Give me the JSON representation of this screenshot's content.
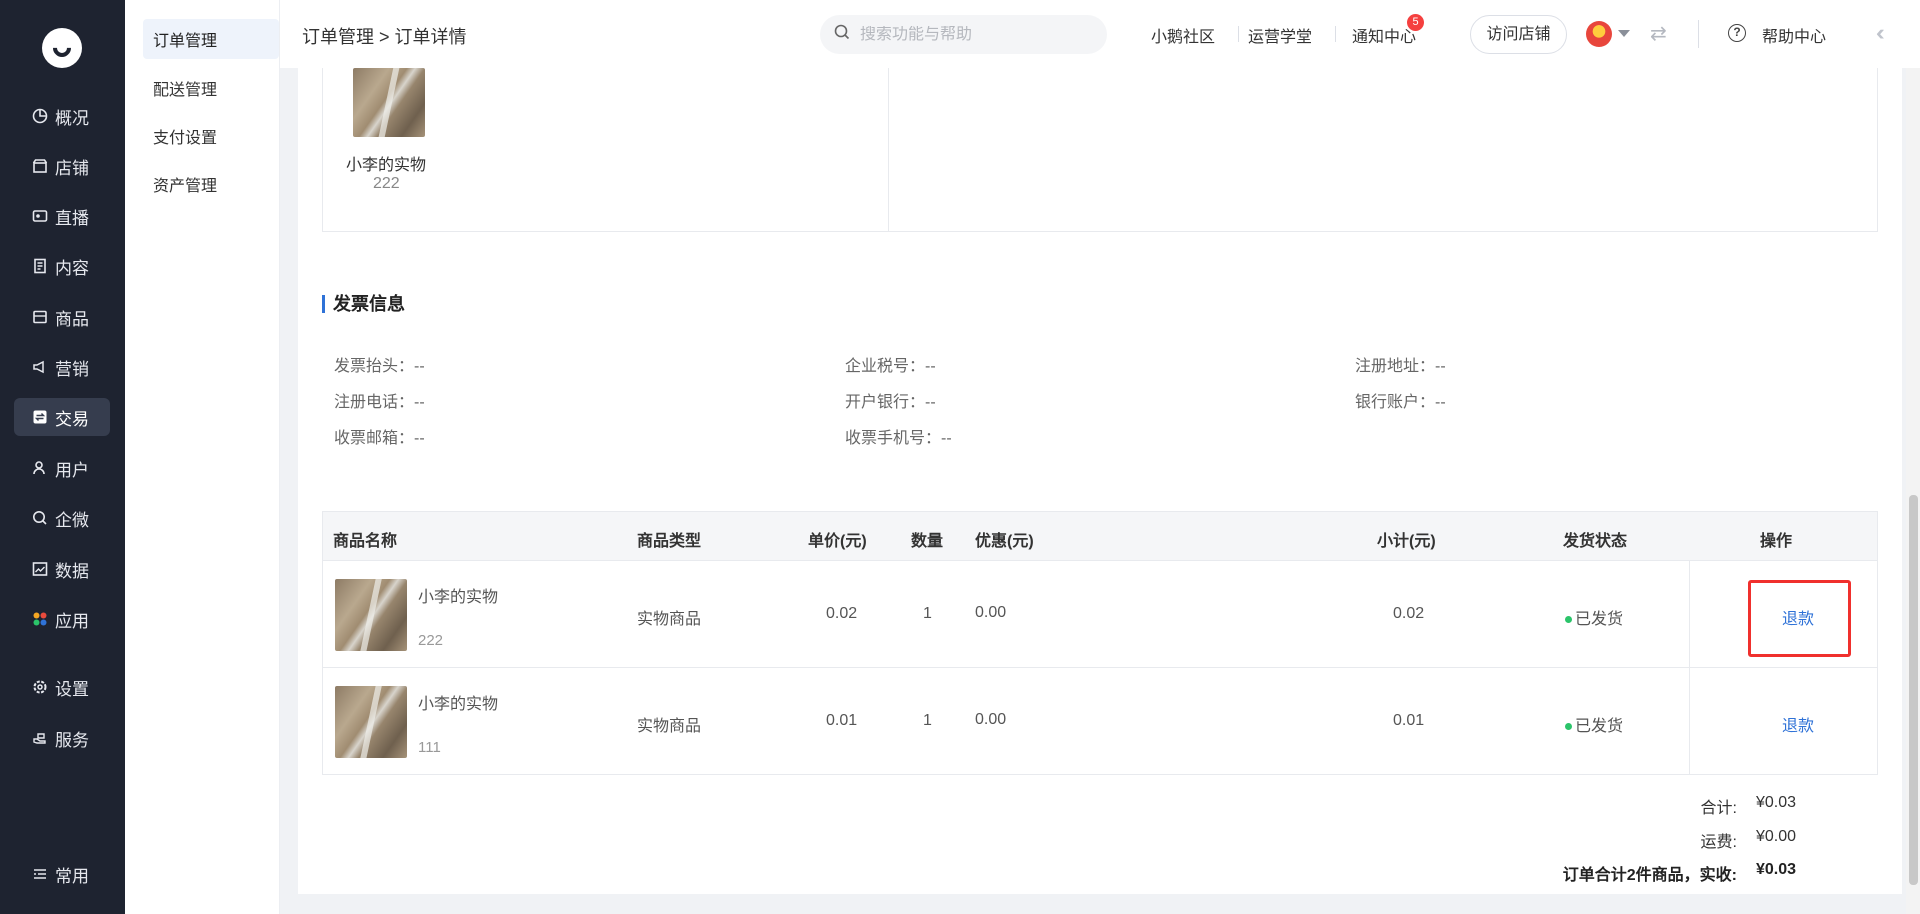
{
  "nav": {
    "items": [
      {
        "label": "概况",
        "icon": "pie-chart-icon"
      },
      {
        "label": "店铺",
        "icon": "store-icon"
      },
      {
        "label": "直播",
        "icon": "live-icon"
      },
      {
        "label": "内容",
        "icon": "document-icon"
      },
      {
        "label": "商品",
        "icon": "box-icon"
      },
      {
        "label": "营销",
        "icon": "megaphone-icon"
      },
      {
        "label": "交易",
        "icon": "exchange-icon"
      },
      {
        "label": "用户",
        "icon": "user-icon"
      },
      {
        "label": "企微",
        "icon": "wecom-icon"
      },
      {
        "label": "数据",
        "icon": "image-chart-icon"
      },
      {
        "label": "应用",
        "icon": "apps-icon"
      },
      {
        "label": "设置",
        "icon": "gear-icon"
      },
      {
        "label": "服务",
        "icon": "service-icon"
      },
      {
        "label": "常用",
        "icon": "list-icon"
      }
    ],
    "active": "交易"
  },
  "submenu": {
    "items": [
      "订单管理",
      "配送管理",
      "支付设置",
      "资产管理"
    ]
  },
  "header": {
    "breadcrumb": "订单管理 > 订单详情",
    "search_placeholder": "搜索功能与帮助",
    "community": "小鹅社区",
    "academy": "运营学堂",
    "notice": "通知中心",
    "notice_count": "5",
    "visit_store": "访问店铺",
    "help": "帮助中心"
  },
  "product_top": {
    "name": "小李的实物",
    "code": "222"
  },
  "invoice": {
    "title": "发票信息",
    "fields": [
      {
        "label": "发票抬头：",
        "value": "--"
      },
      {
        "label": "企业税号：",
        "value": "--"
      },
      {
        "label": "注册地址：",
        "value": "--"
      },
      {
        "label": "注册电话：",
        "value": "--"
      },
      {
        "label": "开户银行：",
        "value": "--"
      },
      {
        "label": "银行账户：",
        "value": "--"
      },
      {
        "label": "收票邮箱：",
        "value": "--"
      },
      {
        "label": "收票手机号：",
        "value": "--"
      }
    ]
  },
  "table": {
    "headers": [
      "商品名称",
      "商品类型",
      "单价(元)",
      "数量",
      "优惠(元)",
      "小计(元)",
      "发货状态",
      "操作"
    ],
    "rows": [
      {
        "name": "小李的实物",
        "code": "222",
        "type": "实物商品",
        "price": "0.02",
        "qty": "1",
        "discount": "0.00",
        "subtotal": "0.02",
        "status": "已发货",
        "action": "退款"
      },
      {
        "name": "小李的实物",
        "code": "111",
        "type": "实物商品",
        "price": "0.01",
        "qty": "1",
        "discount": "0.00",
        "subtotal": "0.01",
        "status": "已发货",
        "action": "退款"
      }
    ]
  },
  "summary": {
    "total_label": "合计:",
    "total_value": "¥0.03",
    "shipping_label": "运费:",
    "shipping_value": "¥0.00",
    "paid_label": "订单合计2件商品，实收:",
    "paid_value": "¥0.03"
  },
  "colors": {
    "sidebar": "#1e2330",
    "accent": "#2f72d7",
    "highlight": "#f0302d",
    "status_green": "#2bc46a"
  }
}
